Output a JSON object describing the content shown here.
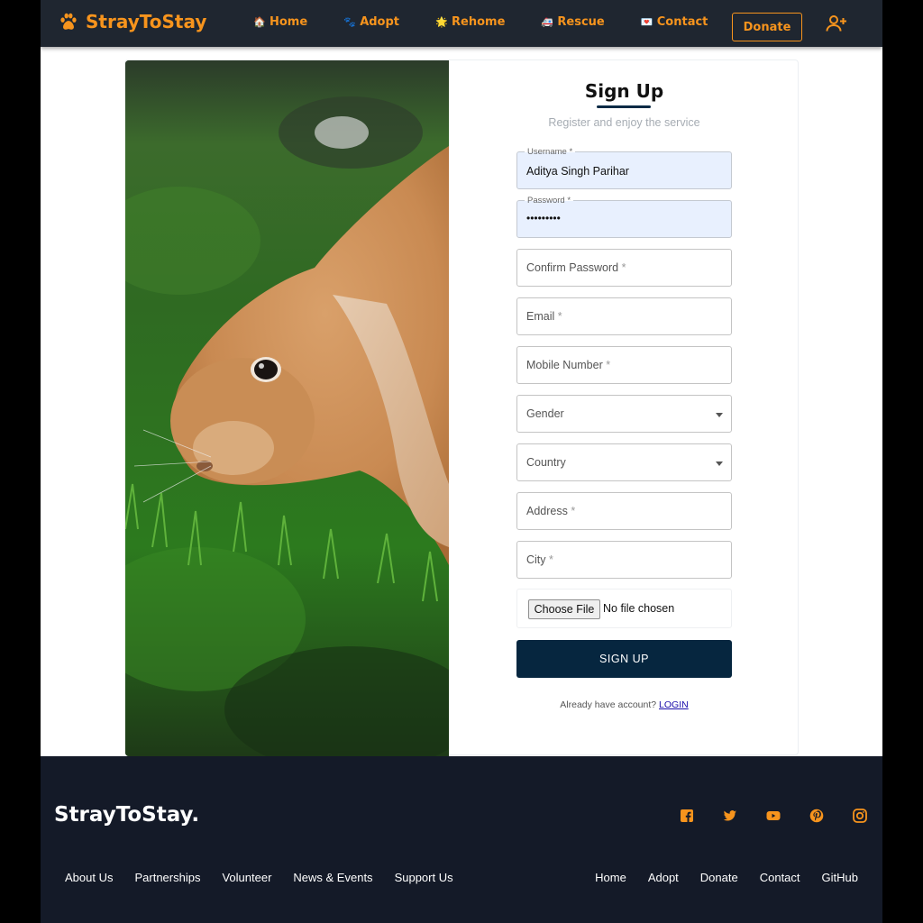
{
  "nav": {
    "brand": "StrayToStay",
    "links": [
      {
        "label": "Home",
        "emoji": "🏠"
      },
      {
        "label": "Adopt",
        "emoji": "🐾"
      },
      {
        "label": "Rehome",
        "emoji": "🌟"
      },
      {
        "label": "Rescue",
        "emoji": "🚑"
      },
      {
        "label": "Contact",
        "emoji": "💌"
      }
    ],
    "donate_label": "Donate",
    "add_user_icon": "user-plus-icon"
  },
  "form": {
    "title": "Sign Up",
    "subtitle": "Register and enjoy the service",
    "username_label": "Username *",
    "username_value": "Aditya Singh Parihar",
    "password_label": "Password *",
    "password_value": "•••••••••",
    "confirm_password_placeholder": "Confirm Password",
    "email_placeholder": "Email",
    "mobile_placeholder": "Mobile Number",
    "gender_placeholder": "Gender",
    "country_placeholder": "Country",
    "address_placeholder": "Address",
    "city_placeholder": "City",
    "required_mark": "*",
    "file_button": "Choose File",
    "file_status": "No file chosen",
    "submit_label": "SIGN UP",
    "login_prompt": "Already have account?",
    "login_link": "LOGIN"
  },
  "footer": {
    "brand": "StrayToStay.",
    "social_icons": [
      "facebook-icon",
      "twitter-icon",
      "youtube-icon",
      "pinterest-icon",
      "instagram-icon"
    ],
    "left_links": [
      "About Us",
      "Partnerships",
      "Volunteer",
      "News & Events",
      "Support Us"
    ],
    "right_links": [
      "Home",
      "Adopt",
      "Donate",
      "Contact",
      "GitHub"
    ]
  },
  "colors": {
    "accent": "#f7941d",
    "nav_bg": "#1f2630",
    "footer_bg": "#141a28",
    "primary_button": "#06263f"
  }
}
